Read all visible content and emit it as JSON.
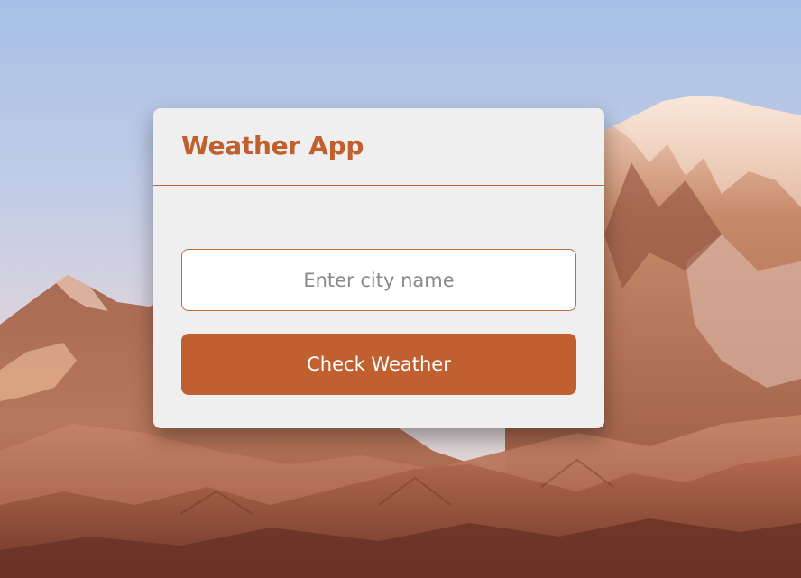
{
  "app": {
    "title": "Weather App"
  },
  "search": {
    "placeholder": "Enter city name",
    "value": ""
  },
  "actions": {
    "check_label": "Check Weather"
  },
  "colors": {
    "accent": "#c0602f",
    "card_background": "#efefef",
    "input_border": "#c06a44",
    "button_text": "#ffffff"
  },
  "background": {
    "image_semantic": "mountain-landscape"
  }
}
